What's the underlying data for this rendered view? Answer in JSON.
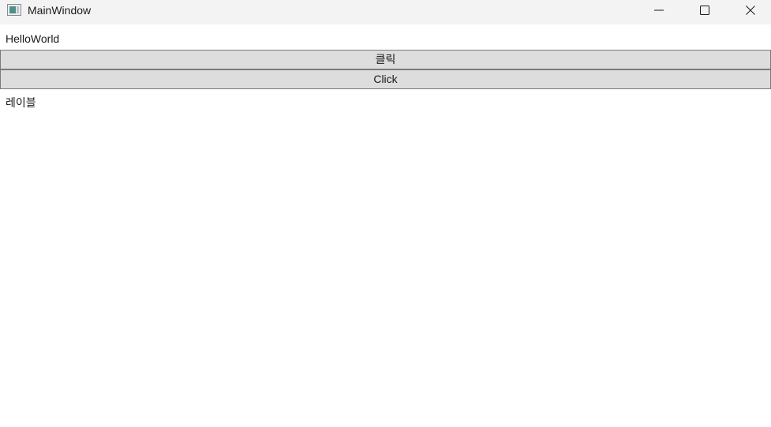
{
  "window": {
    "title": "MainWindow",
    "icons": {
      "app": "app-window-icon",
      "minimize": "minimize-icon",
      "maximize": "maximize-icon",
      "close": "close-icon"
    }
  },
  "content": {
    "hello_label": "HelloWorld",
    "korean_button_label": "클릭",
    "click_button_label": "Click",
    "korean_label": "레이블"
  },
  "colors": {
    "titlebar_bg": "#f3f3f3",
    "button_bg": "#dddddd",
    "button_border": "#7a7a7a",
    "text": "#1a1a1a"
  }
}
